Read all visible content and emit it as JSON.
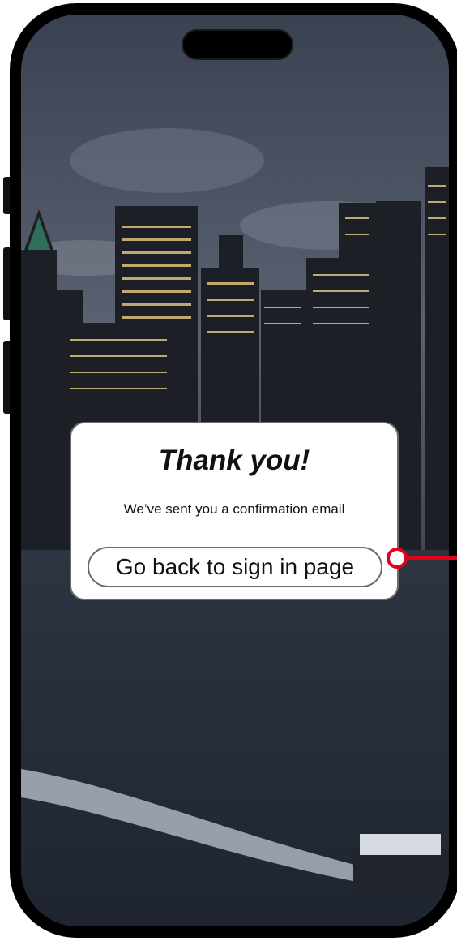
{
  "dialog": {
    "title": "Thank you!",
    "message": "We’ve sent you a confirmation email",
    "button_label": "Go back to sign in page"
  },
  "colors": {
    "annotation": "#e3001b",
    "card_border": "#6b6b6b",
    "card_background": "#ffffff"
  }
}
